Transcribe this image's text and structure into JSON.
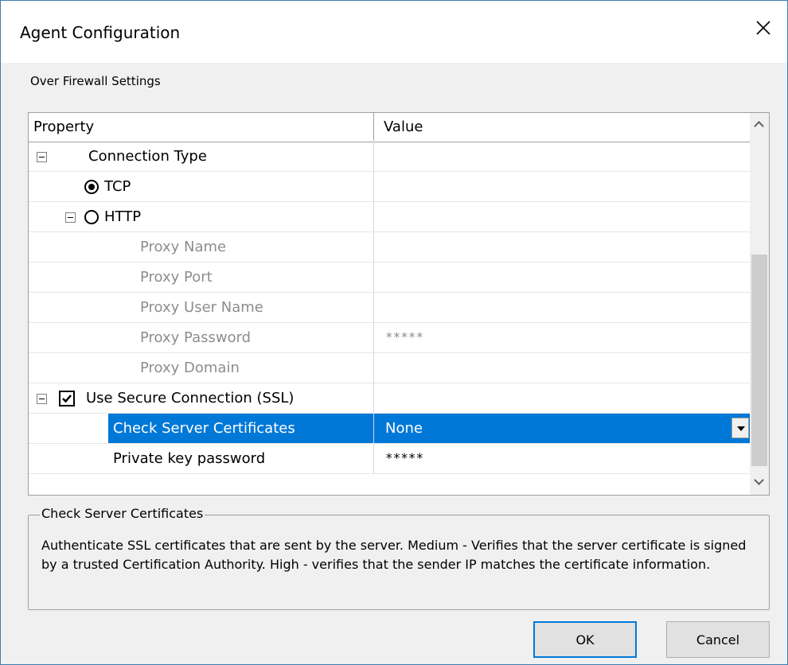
{
  "window": {
    "title": "Agent Configuration",
    "close_icon": "close-icon"
  },
  "section_label": "Over Firewall Settings",
  "grid": {
    "headers": {
      "property": "Property",
      "value": "Value"
    },
    "rows": [
      {
        "label": "Connection Type",
        "value": ""
      },
      {
        "label": "TCP",
        "value": "",
        "selected": true
      },
      {
        "label": "HTTP",
        "value": ""
      },
      {
        "label": "Proxy Name",
        "value": ""
      },
      {
        "label": "Proxy Port",
        "value": ""
      },
      {
        "label": "Proxy User Name",
        "value": ""
      },
      {
        "label": "Proxy Password",
        "value": "*****"
      },
      {
        "label": "Proxy Domain",
        "value": ""
      },
      {
        "label": "Use Secure Connection (SSL)",
        "value": "",
        "checked": true
      },
      {
        "label": "Check Server Certificates",
        "value": "None"
      },
      {
        "label": "Private key password",
        "value": "*****"
      }
    ]
  },
  "description": {
    "title": "Check Server Certificates",
    "text": "Authenticate SSL certificates that are sent by the server. Medium - Verifies that the server certificate is signed by a trusted Certification Authority. High - verifies that the sender IP matches the certificate information."
  },
  "buttons": {
    "ok": "OK",
    "cancel": "Cancel"
  },
  "colors": {
    "selection": "#0078d7",
    "disabled_text": "#8d8d8d",
    "window_bg": "#f0f0f0"
  }
}
